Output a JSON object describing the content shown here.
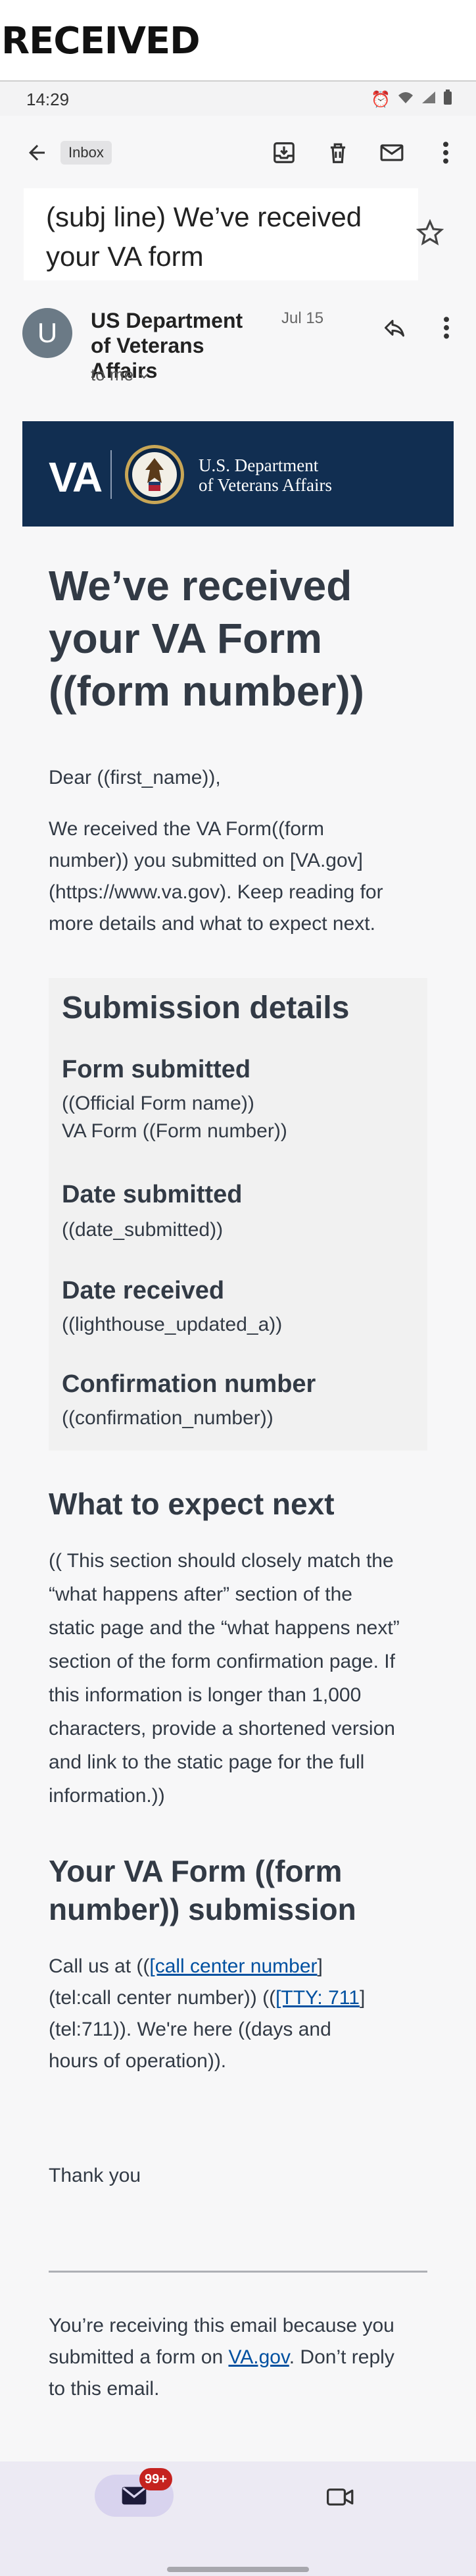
{
  "banner": {
    "title": "RECEIVED"
  },
  "status_bar": {
    "time": "14:29"
  },
  "app_bar": {
    "folder_chip": "Inbox"
  },
  "email": {
    "subject": "(subj line) We’ve received your VA form",
    "sender_name": "US Department of Veterans Affairs",
    "avatar_letter": "U",
    "date": "Jul 15",
    "to": "to me"
  },
  "va_header": {
    "logo": "VA",
    "dept_line1": "U.S. Department",
    "dept_line2": "of Veterans Affairs",
    "brand_color": "#112e51"
  },
  "body": {
    "headline_1": "We’ve received",
    "headline_2": "your VA Form",
    "headline_3": "((form number))",
    "greeting": "Dear ((first_name)),",
    "intro_1": "We received the VA Form((form",
    "intro_2": "number)) you submitted on [VA.gov]",
    "intro_3": "(https://www.va.gov). Keep reading for",
    "intro_4": "more details and what to expect next.",
    "details": {
      "title": "Submission details",
      "form_label": "Form submitted",
      "form_value_1": "((Official Form name))",
      "form_value_2": "VA Form ((Form number))",
      "date_sub_label": "Date submitted",
      "date_sub_value": "((date_submitted))",
      "date_rec_label": "Date received",
      "date_rec_value": "((lighthouse_updated_a))",
      "conf_label": "Confirmation number",
      "conf_value": "((confirmation_number))"
    },
    "next_title": "What to expect next",
    "next_lines": [
      "(( This section should closely match the",
      "“what happens after” section of the",
      "static page and the “what happens next”",
      "section of the form confirmation page. If",
      "this information is longer than 1,000",
      "characters, provide a shortened version",
      "and link to the static page for the full",
      "information.))"
    ],
    "submission_title_1": "Your VA Form ((form",
    "submission_title_2": "number)) submission",
    "call_prefix": "Call us at ((",
    "call_link": "[call center number",
    "call_suffix": "]",
    "call_line2_a": "(tel:call center number)) ((",
    "tty_link": "[TTY: 711",
    "tty_suffix": "]",
    "call_line3": "(tel:711)). We're here ((days and",
    "call_line4": "hours of operation)).",
    "thanks": "Thank you",
    "footer_1": "You’re receiving this email because you",
    "footer_2_a": "submitted a form on ",
    "footer_link": "VA.gov",
    "footer_2_b": ". Don’t reply",
    "footer_3": "to this email."
  },
  "bottom_nav": {
    "mail_badge": "99+"
  }
}
